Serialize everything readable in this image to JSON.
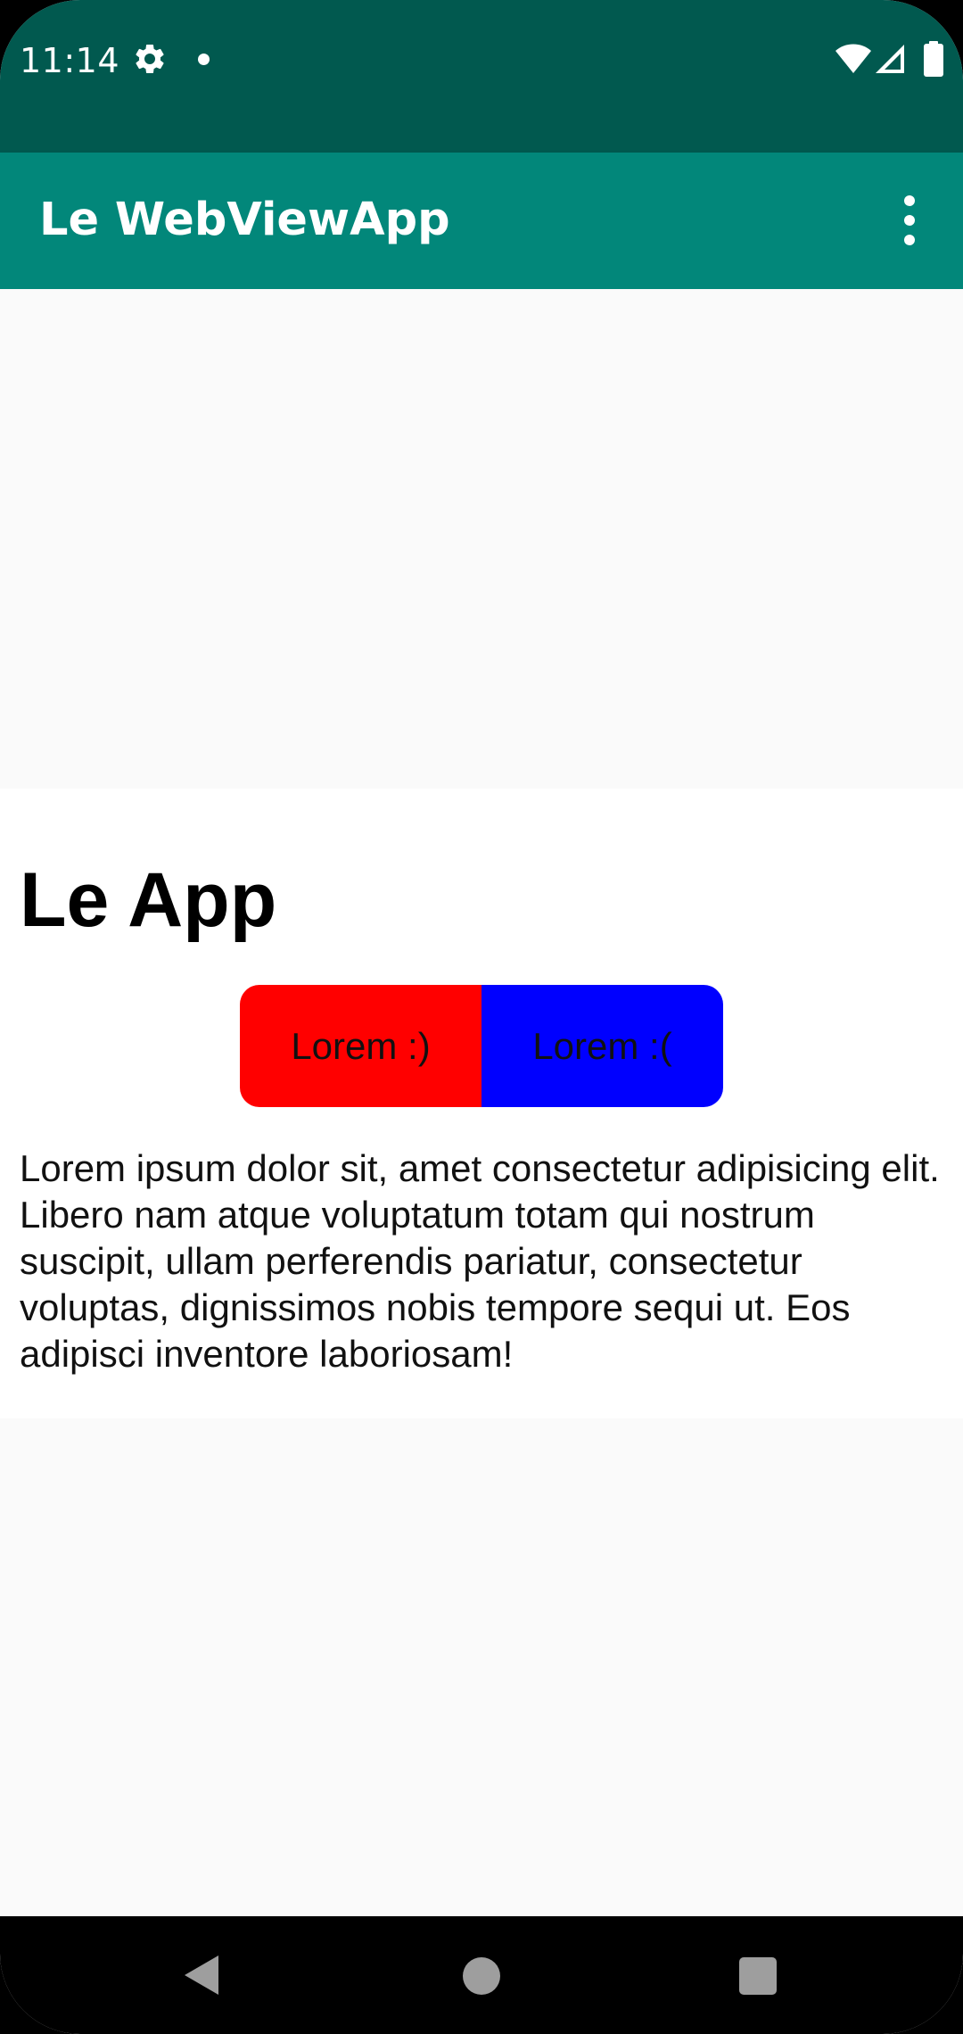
{
  "status_bar": {
    "time": "11:14",
    "icons": [
      "gear-icon",
      "notification-dot-icon",
      "wifi-icon",
      "cell-signal-icon",
      "battery-icon"
    ]
  },
  "app_bar": {
    "title": "Le WebViewApp",
    "menu_icon": "more-vert-icon"
  },
  "page": {
    "heading": "Le App",
    "buttons": [
      {
        "label": "Lorem :)",
        "color": "#ff0000"
      },
      {
        "label": "Lorem :(",
        "color": "#0000ff"
      }
    ],
    "paragraph": "Lorem ipsum dolor sit, amet consectetur adipisicing elit. Libero nam atque voluptatum totam qui nostrum suscipit, ullam perferendis pariatur, consectetur voluptas, dignissimos nobis tempore sequi ut. Eos adipisci inventore laboriosam!"
  },
  "nav_bar": {
    "icons": [
      "back-icon",
      "home-icon",
      "recents-icon"
    ]
  },
  "colors": {
    "status_bar": "#01594f",
    "app_bar": "#02877a",
    "webview_background": "#fafafa"
  }
}
